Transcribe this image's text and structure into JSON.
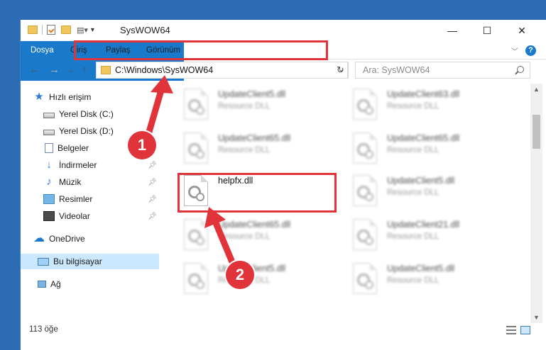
{
  "window": {
    "title": "SysWOW64",
    "minimize": "—",
    "maximize": "☐",
    "close": "✕"
  },
  "ribbon": {
    "tabs": [
      "Dosya",
      "Giriş",
      "Paylaş",
      "Görünüm"
    ]
  },
  "address": {
    "path": "C:\\Windows\\SysWOW64",
    "search_placeholder": "Ara: SysWOW64"
  },
  "sidebar": {
    "items": [
      {
        "label": "Hızlı erişim",
        "icon": "star-icon"
      },
      {
        "label": "Yerel Disk (C:)",
        "icon": "drive-icon"
      },
      {
        "label": "Yerel Disk (D:)",
        "icon": "drive-icon"
      },
      {
        "label": "Belgeler",
        "icon": "documents-icon"
      },
      {
        "label": "İndirmeler",
        "icon": "download-icon"
      },
      {
        "label": "Müzik",
        "icon": "music-icon"
      },
      {
        "label": "Resimler",
        "icon": "pictures-icon"
      },
      {
        "label": "Videolar",
        "icon": "video-icon"
      },
      {
        "label": "OneDrive",
        "icon": "cloud-icon"
      },
      {
        "label": "Bu bilgisayar",
        "icon": "computer-icon"
      },
      {
        "label": "Ağ",
        "icon": "network-icon"
      }
    ]
  },
  "files": [
    {
      "name": "UpdateClient5.dll",
      "type": "Resource DLL"
    },
    {
      "name": "UpdateClient63.dll",
      "type": "Resource DLL"
    },
    {
      "name": "UpdateClient65.dll",
      "type": "Resource DLL"
    },
    {
      "name": "UpdateClient65.dll",
      "type": "Resource DLL"
    },
    {
      "name": "helpfx.dll",
      "type": ""
    },
    {
      "name": "UpdateClient5.dll",
      "type": "Resource DLL"
    },
    {
      "name": "UpdateClient65.dll",
      "type": "Resource DLL"
    },
    {
      "name": "UpdateClient21.dll",
      "type": "Resource DLL"
    },
    {
      "name": "UpdateClient5.dll",
      "type": "Resource DLL"
    },
    {
      "name": "UpdateClient5.dll",
      "type": "Resource DLL"
    }
  ],
  "status": {
    "item_count": "113 öğe"
  },
  "callouts": {
    "one": "1",
    "two": "2"
  },
  "colors": {
    "accent": "#1979ca",
    "highlight": "#e0343a",
    "selected": "#cce8ff"
  }
}
